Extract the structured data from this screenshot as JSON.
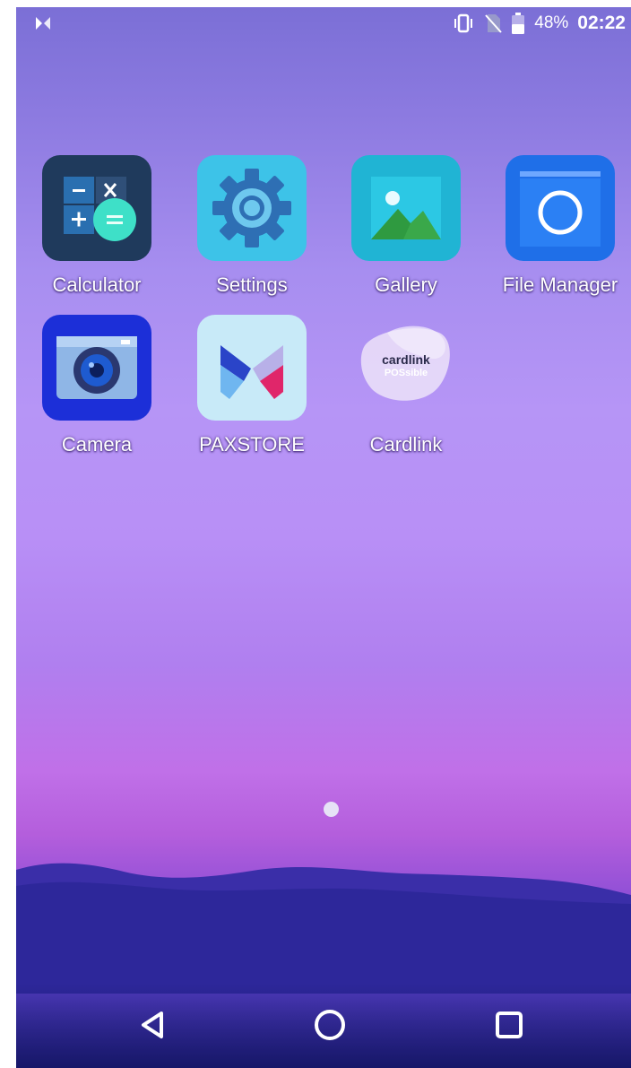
{
  "status_bar": {
    "left_icon": "pax-logo-icon",
    "right_icons": [
      "vibrate-icon",
      "no-sim-icon",
      "battery-icon"
    ],
    "battery_percent": "48%",
    "time": "02:22"
  },
  "apps": [
    {
      "label": "Calculator",
      "icon": "calculator-icon"
    },
    {
      "label": "Settings",
      "icon": "gear-icon"
    },
    {
      "label": "Gallery",
      "icon": "gallery-icon"
    },
    {
      "label": "File Manager",
      "icon": "folder-icon"
    },
    {
      "label": "Camera",
      "icon": "camera-icon"
    },
    {
      "label": "PAXSTORE",
      "icon": "paxstore-icon"
    },
    {
      "label": "Cardlink",
      "icon": "cardlink-icon",
      "logo_text": "cardlink",
      "logo_subtext": "POSsible"
    }
  ],
  "page_indicator": {
    "current": 1,
    "total": 1
  },
  "nav_bar": {
    "back": "back-icon",
    "home": "home-icon",
    "recents": "recents-icon"
  },
  "colors": {
    "calculator_bg": "#1f3a5c",
    "settings_bg": "#3dc3e8",
    "gallery_bg": "#20b4d4",
    "file_manager_bg": "#1f6fe8",
    "camera_bg": "#1c2fd8",
    "paxstore_bg": "#c8eaf8"
  }
}
